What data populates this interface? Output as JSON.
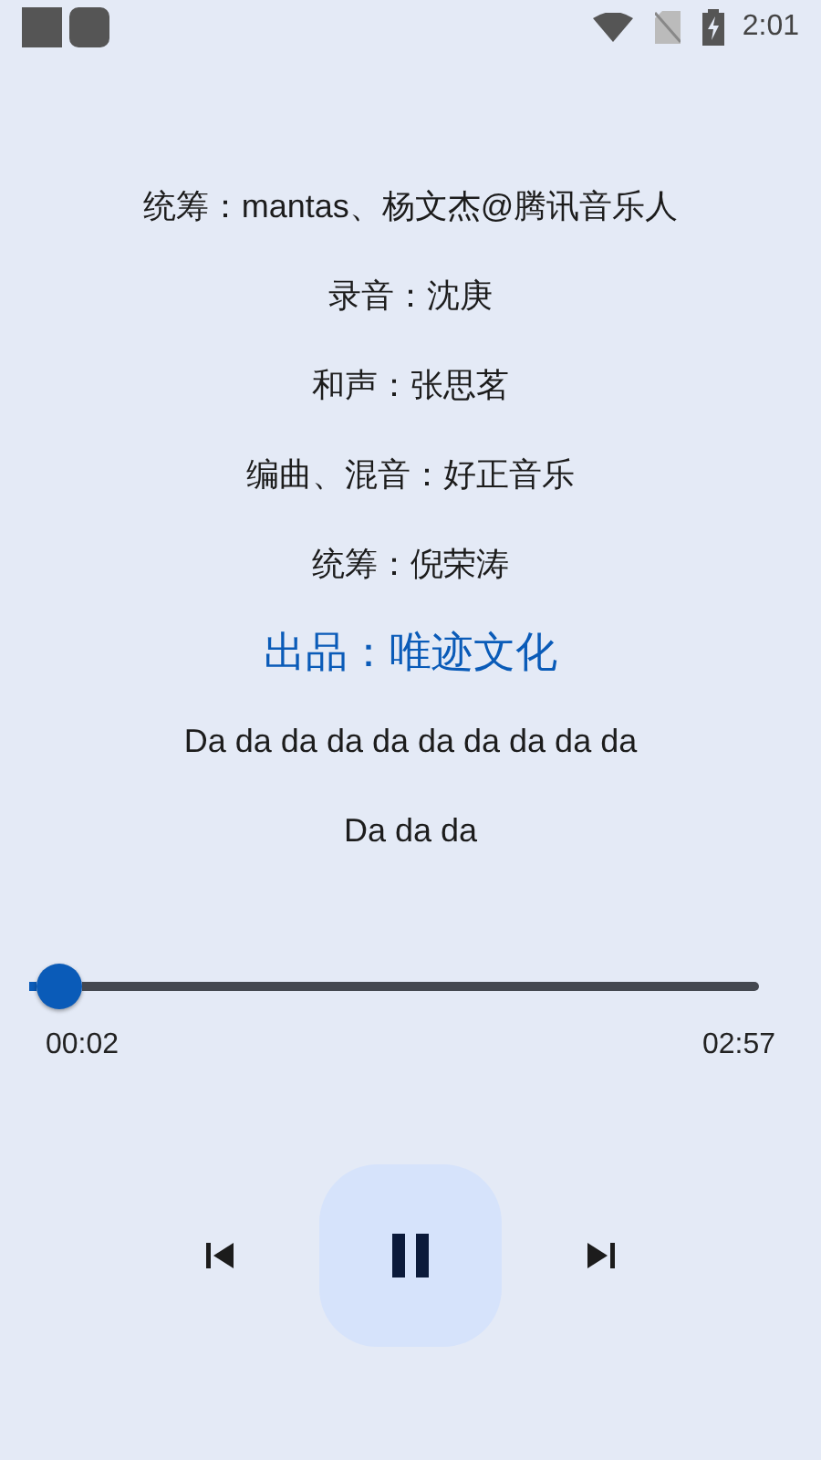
{
  "status_bar": {
    "time": "2:01"
  },
  "lyrics": [
    {
      "text": "统筹：mantas、杨文杰@腾讯音乐人",
      "selected": false
    },
    {
      "text": "录音：沈庚",
      "selected": false
    },
    {
      "text": "和声：张思茗",
      "selected": false
    },
    {
      "text": "编曲、混音：好正音乐",
      "selected": false
    },
    {
      "text": "统筹：倪荣涛",
      "selected": false
    },
    {
      "text": "出品：唯迹文化",
      "selected": true
    },
    {
      "text": "Da da da da da da da da da da",
      "selected": false
    },
    {
      "text": "Da da da",
      "selected": false
    }
  ],
  "progress": {
    "level": 0.011,
    "elapsed": "00:02",
    "duration": "02:57"
  },
  "controls": {
    "playing": true
  }
}
